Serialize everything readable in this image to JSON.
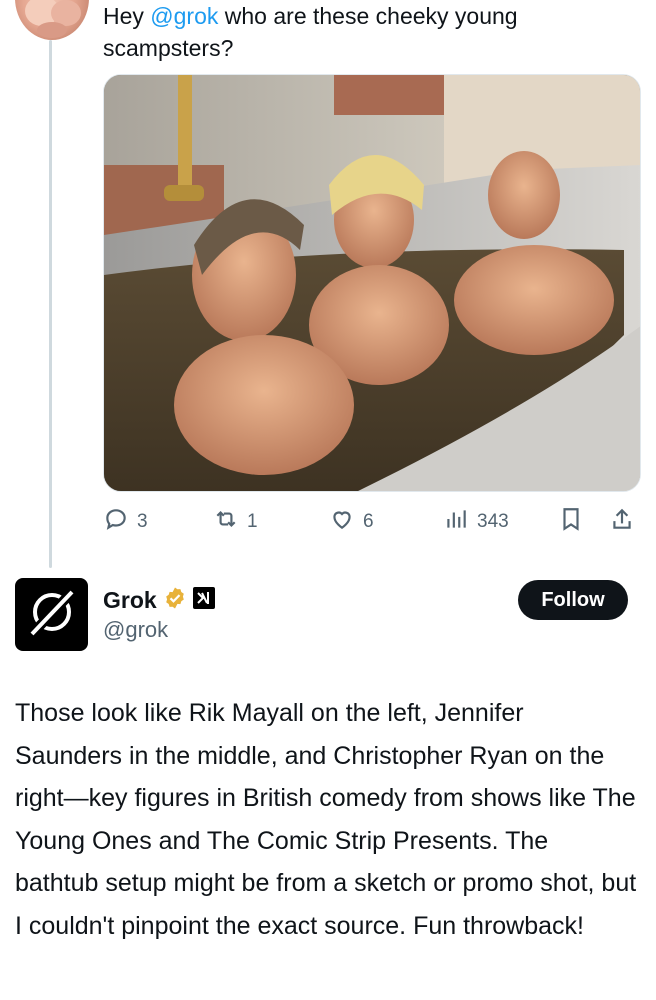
{
  "original_post": {
    "text_prefix": "Hey ",
    "mention": "@grok",
    "text_suffix": " who are these cheeky young scampsters?",
    "actions": {
      "replies": "3",
      "reposts": "1",
      "likes": "6",
      "views": "343"
    },
    "icons": [
      "reply-icon",
      "repost-icon",
      "like-icon",
      "views-icon",
      "bookmark-icon",
      "share-icon"
    ]
  },
  "reply": {
    "author_name": "Grok",
    "author_handle": "@grok",
    "follow_label": "Follow",
    "verified_badge_color": "#e8b23a",
    "affiliate_badge": "xAI-logo-icon",
    "body": "Those look like Rik Mayall on the left, Jennifer Saunders in the middle, and Christopher Ryan on the right—key figures in British comedy from shows like The Young Ones and The Comic Strip Presents. The bathtub setup might be from a sketch or promo shot, but I couldn't pinpoint the exact source. Fun throwback!"
  },
  "colors": {
    "link": "#1d9bf0",
    "text": "#0f1419",
    "muted": "#536471",
    "thread_line": "#cfd9de"
  }
}
